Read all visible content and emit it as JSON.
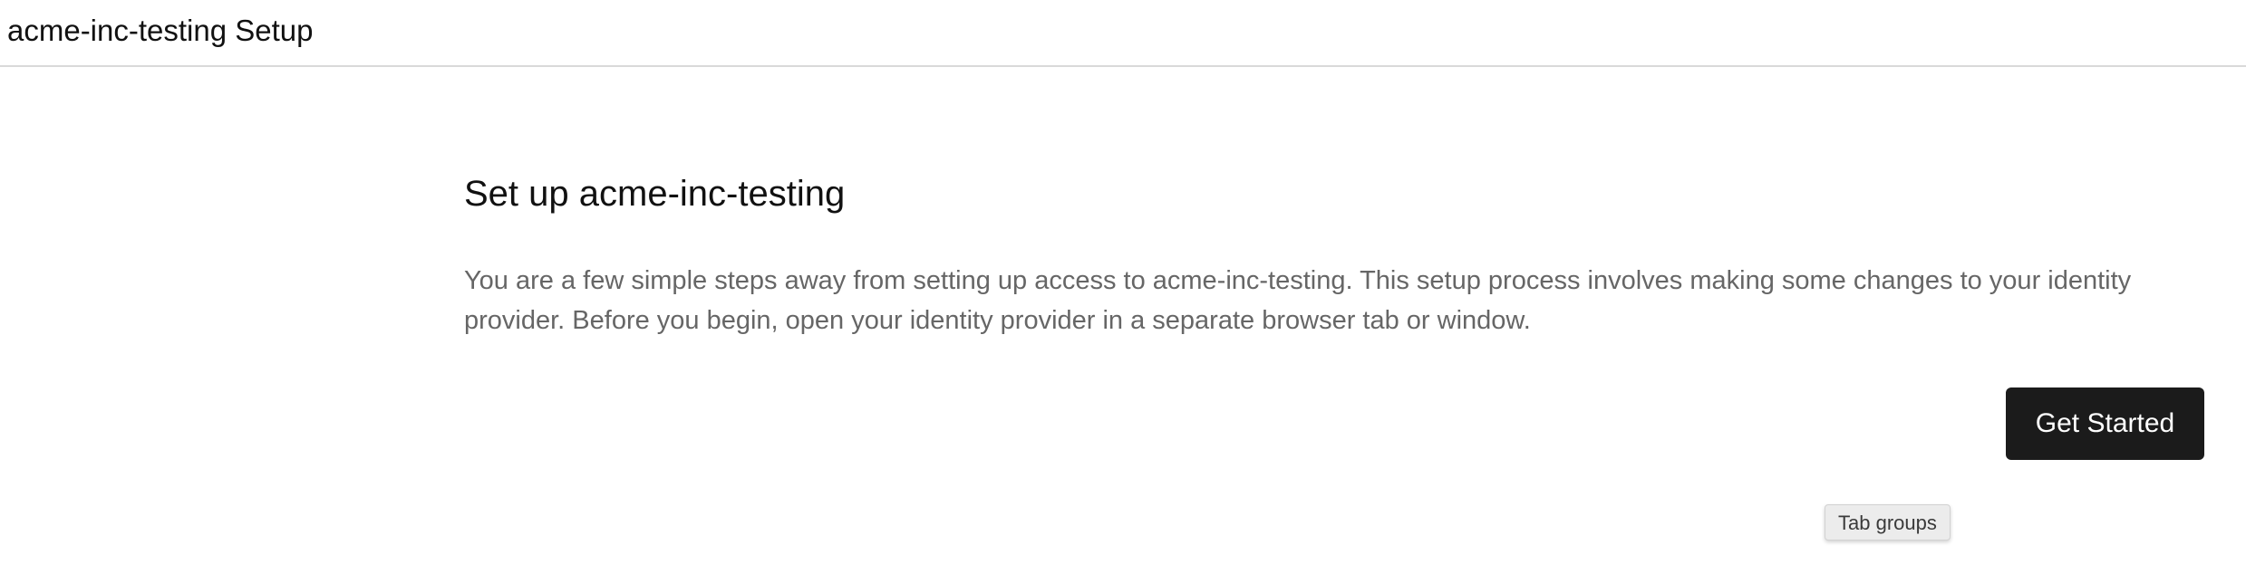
{
  "header": {
    "title": "acme-inc-testing Setup"
  },
  "main": {
    "heading": "Set up acme-inc-testing",
    "description": "You are a few simple steps away from setting up access to acme-inc-testing. This setup process involves making some changes to your identity provider. Before you begin, open your identity provider in a separate browser tab or window.",
    "primary_button_label": "Get Started"
  },
  "tooltip": {
    "text": "Tab groups"
  },
  "colors": {
    "primary_button_bg": "#1b1b1b",
    "description_text": "#666666",
    "divider": "#d9d9d9"
  }
}
